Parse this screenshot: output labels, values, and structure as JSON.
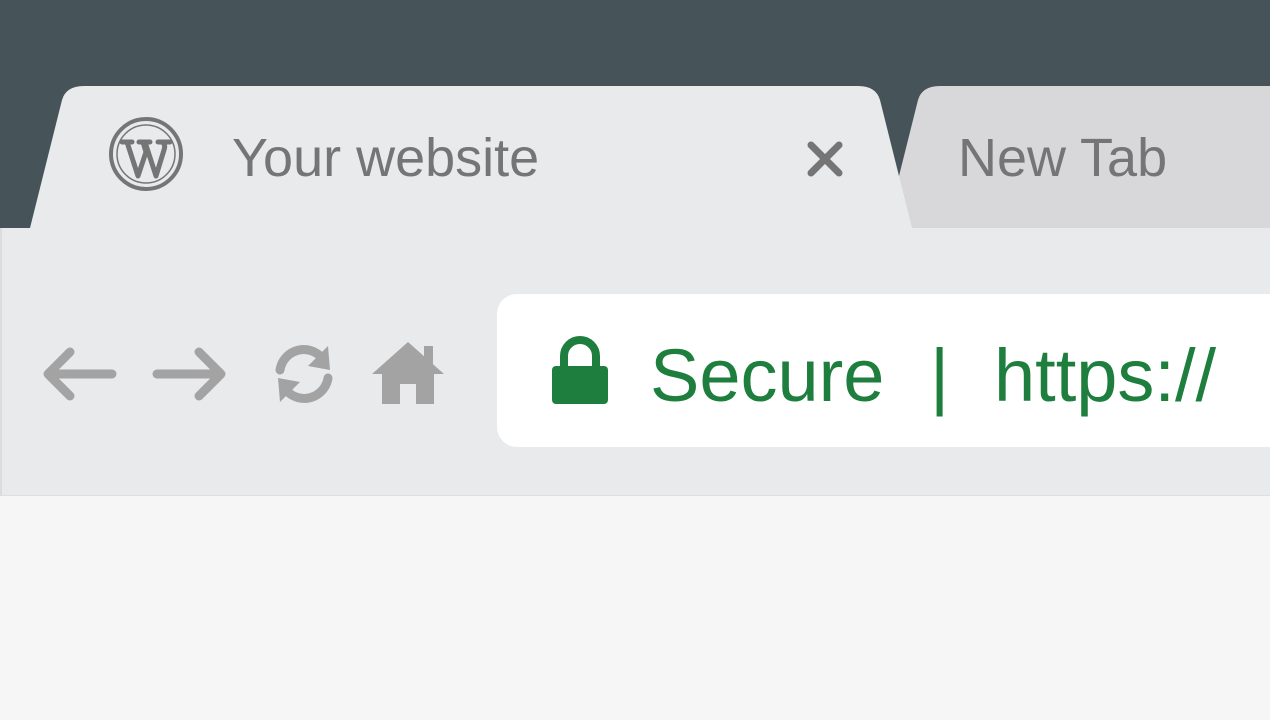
{
  "colors": {
    "titlebar": "#465459",
    "active_tab": "#e9eaec",
    "inactive_tab": "#d8d8da",
    "toolbar": "#e9eaec",
    "omnibox": "#ffffff",
    "secure_green": "#1e7e3e",
    "icon_gray": "#a3a3a3",
    "tab_text": "#757575",
    "content": "#f6f6f6"
  },
  "tabs": [
    {
      "title": "Your website",
      "favicon": "wordpress-icon",
      "active": true,
      "close_icon": "close-icon"
    },
    {
      "title": "New Tab",
      "active": false
    }
  ],
  "toolbar": {
    "buttons": [
      {
        "name": "back",
        "icon": "arrow-left-icon"
      },
      {
        "name": "forward",
        "icon": "arrow-right-icon"
      },
      {
        "name": "reload",
        "icon": "reload-icon"
      },
      {
        "name": "home",
        "icon": "home-icon"
      }
    ]
  },
  "omnibox": {
    "security_icon": "lock-icon",
    "security_label": "Secure",
    "separator": "|",
    "url": "https://"
  }
}
